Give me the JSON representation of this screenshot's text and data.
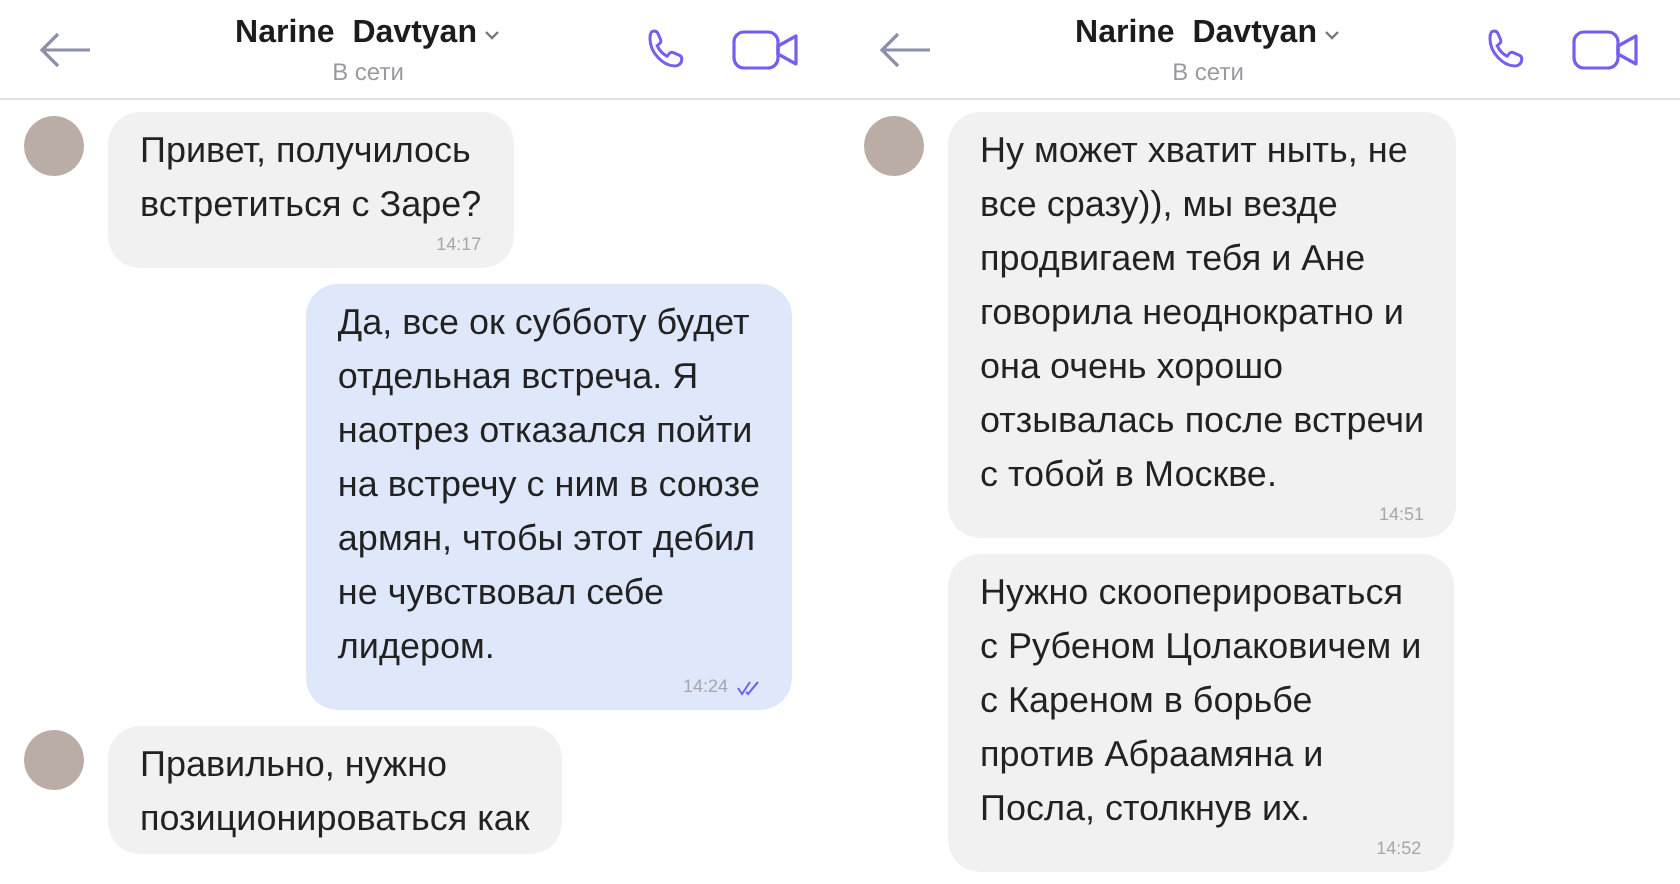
{
  "panels": [
    {
      "header": {
        "name": "Narine  Davtyan",
        "status": "В сети"
      },
      "messages": [
        {
          "kind": "incoming",
          "avatar": true,
          "text": "Привет, получилось\nвстретиться с Заре?",
          "time": "14:17"
        },
        {
          "kind": "outgoing",
          "text": "Да, все ок субботу будет\nотдельная встреча. Я\nнаотрез отказался пойти\nна встречу с ним в союзе\nармян, чтобы этот дебил\nне чувствовал себе\nлидером.",
          "time": "14:24"
        },
        {
          "kind": "incoming",
          "avatar": true,
          "text": "Правильно, нужно\nпозиционироваться как"
        }
      ]
    },
    {
      "header": {
        "name": "Narine  Davtyan",
        "status": "В сети"
      },
      "messages": [
        {
          "kind": "incoming",
          "avatar": true,
          "text": "Ну может хватит ныть, не\nвсе сразу)), мы везде\nпродвигаем тебя и Ане\nговорила неоднократно и\nона очень хорошо\nотзывалась после встречи\nс тобой в Москве.",
          "time": "14:51"
        },
        {
          "kind": "incoming",
          "avatar": false,
          "text": "Нужно скооперироваться\nс Рубеном Цолаковичем и\nс Кареном в борьбе\nпротив Абраамяна и\nПосла, столкнув их.",
          "time": "14:52"
        }
      ]
    }
  ]
}
